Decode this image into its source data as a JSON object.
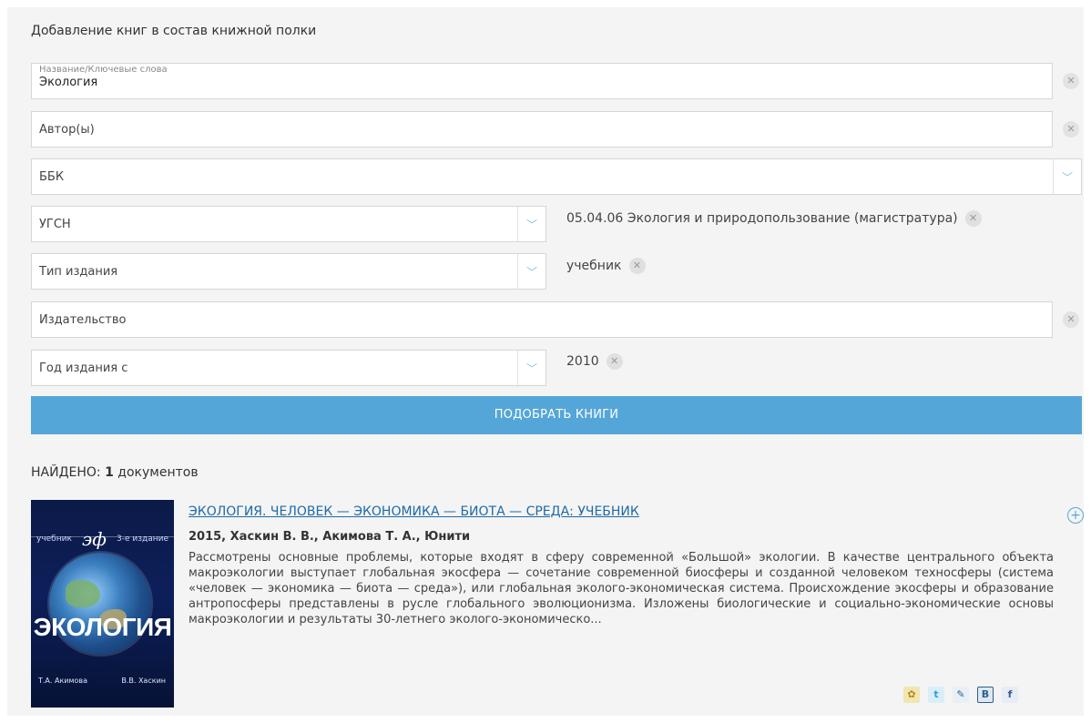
{
  "heading": "Добавление книг в состав книжной полки",
  "fields": {
    "keywords": {
      "label": "Название/Ключевые слова",
      "value": "Экология"
    },
    "authors": {
      "label": "Автор(ы)"
    },
    "bbk": {
      "label": "ББК"
    },
    "ugsn": {
      "label": "УГСН"
    },
    "edition_type": {
      "label": "Тип издания"
    },
    "publisher": {
      "label": "Издательство"
    },
    "year_from": {
      "label": "Год издания с"
    }
  },
  "selected": {
    "ugsn": "05.04.06 Экология и природопользование (магистратура)",
    "edition_type": "учебник",
    "year_from": "2010"
  },
  "submit_label": "ПОДОБРАТЬ КНИГИ",
  "results": {
    "found_prefix": "НАЙДЕНО:",
    "found_count": "1",
    "found_suffix": "документов"
  },
  "book": {
    "title": "ЭКОЛОГИЯ. ЧЕЛОВЕК — ЭКОНОМИКА — БИОТА — СРЕДА: УЧЕБНИК",
    "meta": "2015, Хаскин В. В., Акимова Т. А., Юнити",
    "description": "Рассмотрены основные проблемы, которые входят в сферу современной «Большой» экологии. В качестве центрального объекта макроэкологии выступает глобальная экосфера — сочетание современной биосферы и созданной человеком техносферы (система «человек — экономика — биота — среда»), или глобальная эколого-экономическая система. Происхождение экосферы и образование антропосферы представлены в русле глобального эволюционизма. Изложены биологические и социально-экономические основы макроэкологии и результаты 30-летнего эколого-экономическо...",
    "cover": {
      "top_left": "учебник",
      "logo": "эф",
      "top_right": "3-е издание",
      "title": "ЭКОЛОГИЯ",
      "author_left": "Т.А. Акимова",
      "author_right": "В.В. Хаскин"
    }
  },
  "share_icons": [
    "bug-share-icon",
    "twitter-icon",
    "livejournal-icon",
    "vkontakte-icon",
    "facebook-icon"
  ],
  "share_glyphs": [
    "✿",
    "t",
    "✎",
    "B",
    "f"
  ],
  "colors": {
    "accent": "#54a6d8",
    "link": "#1e6aa5",
    "panel": "#f4f4f4"
  }
}
